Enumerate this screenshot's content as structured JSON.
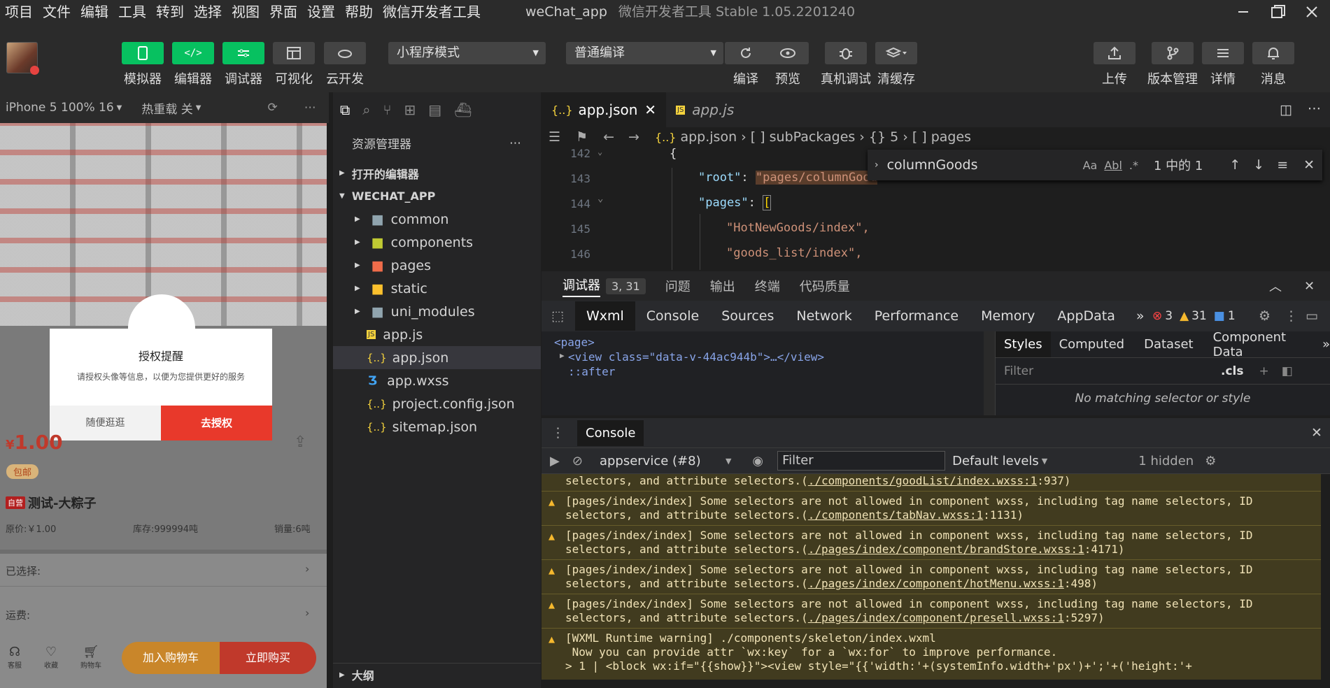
{
  "menu": {
    "items": [
      "项目",
      "文件",
      "编辑",
      "工具",
      "转到",
      "选择",
      "视图",
      "界面",
      "设置",
      "帮助",
      "微信开发者工具"
    ],
    "app_title": "weChat_app",
    "app_subtitle": "微信开发者工具 Stable 1.05.2201240"
  },
  "toolbar": {
    "simulator": "模拟器",
    "editor": "编辑器",
    "debugger": "调试器",
    "visual": "可视化",
    "cloud": "云开发",
    "mode": "小程序模式",
    "compile_mode": "普通编译",
    "compile": "编译",
    "preview": "预览",
    "remote_debug": "真机调试",
    "clear_cache": "清缓存",
    "upload": "上传",
    "version": "版本管理",
    "details": "详情",
    "messages": "消息"
  },
  "sim": {
    "device": "iPhone 5 100% 16",
    "hot_reload": "热重载 关",
    "modal_title": "授权提醒",
    "modal_text": "请授权头像等信息，以便为您提供更好的服务",
    "modal_cancel": "随便逛逛",
    "modal_ok": "去授权",
    "price": "1.00",
    "currency": "¥",
    "shipping_tag": "包邮",
    "self_tag": "自营",
    "product_name": "测试-大粽子",
    "orig_price": "原价:￥1.00",
    "stock": "库存:999994吨",
    "sales": "销量:6吨",
    "selected": "已选择:",
    "freight": "运费:",
    "nav_service": "客服",
    "nav_fav": "收藏",
    "nav_cart": "购物车",
    "add_cart": "加入购物车",
    "buy_now": "立即购买"
  },
  "explorer": {
    "title": "资源管理器",
    "open_editors": "打开的编辑器",
    "project": "WECHAT_APP",
    "outline": "大纲",
    "items": [
      {
        "name": "common",
        "kind": "folder"
      },
      {
        "name": "components",
        "kind": "folder"
      },
      {
        "name": "pages",
        "kind": "folder"
      },
      {
        "name": "static",
        "kind": "folder"
      },
      {
        "name": "uni_modules",
        "kind": "folder"
      },
      {
        "name": "app.js",
        "kind": "js"
      },
      {
        "name": "app.json",
        "kind": "json"
      },
      {
        "name": "app.wxss",
        "kind": "css"
      },
      {
        "name": "project.config.json",
        "kind": "json"
      },
      {
        "name": "sitemap.json",
        "kind": "json"
      }
    ]
  },
  "editor": {
    "tab1": "app.json",
    "tab2": "app.js",
    "breadcrumb": {
      "file": "app.json",
      "p1": "[ ] subPackages",
      "p2": "{} 5",
      "p3": "[ ] pages"
    },
    "lines": [
      {
        "n": "142",
        "text": "{"
      },
      {
        "n": "143",
        "key": "\"root\"",
        "colon": ": ",
        "val": "\"pages/columnGood"
      },
      {
        "n": "144",
        "key": "\"pages\"",
        "colon": ": ",
        "val": "["
      },
      {
        "n": "145",
        "text": "\"HotNewGoods/index\","
      },
      {
        "n": "146",
        "text": "\"goods_list/index\","
      }
    ],
    "find_query": "columnGoods",
    "find_count": "1 中的 1",
    "find_aa": "Aa",
    "find_ab": "Abl"
  },
  "debug": {
    "tab_debugger": "调试器",
    "badge": "3, 31",
    "tab_issues": "问题",
    "tab_output": "输出",
    "tab_terminal": "终端",
    "tab_quality": "代码质量",
    "devtabs": [
      "Wxml",
      "Console",
      "Sources",
      "Network",
      "Performance",
      "Memory",
      "AppData"
    ],
    "errors": "3",
    "warnings": "31",
    "infos": "1",
    "wxml_lines": [
      "<page>",
      "<view class=\"data-v-44ac944b\">…</view>",
      "::after"
    ],
    "styles_tabs": [
      "Styles",
      "Computed",
      "Dataset",
      "Component Data"
    ],
    "filter_placeholder": "Filter",
    "cls": ".cls",
    "no_match": "No matching selector or style",
    "console_title": "Console",
    "context": "appservice (#8)",
    "levels": "Default levels",
    "hidden": "1 hidden",
    "logs": [
      {
        "a": "selectors, and attribute selectors.(",
        "link": "./components/goodList/index.wxss:1",
        "b": ":937)",
        "top": true
      },
      {
        "a": "[pages/index/index] Some selectors are not allowed in component wxss, including tag name selectors, ID",
        "a2": "selectors, and attribute selectors.(",
        "link": "./components/tabNav.wxss:1",
        "b": ":1131)"
      },
      {
        "a": "[pages/index/index] Some selectors are not allowed in component wxss, including tag name selectors, ID",
        "a2": "selectors, and attribute selectors.(",
        "link": "./pages/index/component/brandStore.wxss:1",
        "b": ":4171)"
      },
      {
        "a": "[pages/index/index] Some selectors are not allowed in component wxss, including tag name selectors, ID",
        "a2": "selectors, and attribute selectors.(",
        "link": "./pages/index/component/hotMenu.wxss:1",
        "b": ":498)"
      },
      {
        "a": "[pages/index/index] Some selectors are not allowed in component wxss, including tag name selectors, ID",
        "a2": "selectors, and attribute selectors.(",
        "link": "./pages/index/component/presell.wxss:1",
        "b": ":5297)"
      }
    ],
    "runtime_warn": "[WXML Runtime warning] ./components/skeleton/index.wxml",
    "runtime_l2": " Now you can provide attr `wx:key` for a `wx:for` to improve performance.",
    "runtime_l3": "> 1 | <block wx:if=\"{{show}}\"><view style=\"{{'width:'+(systemInfo.width+'px')+';'+('height:'+"
  },
  "colors": {
    "green": "#07c160",
    "red": "#e8392b",
    "orange": "#f29a25"
  }
}
